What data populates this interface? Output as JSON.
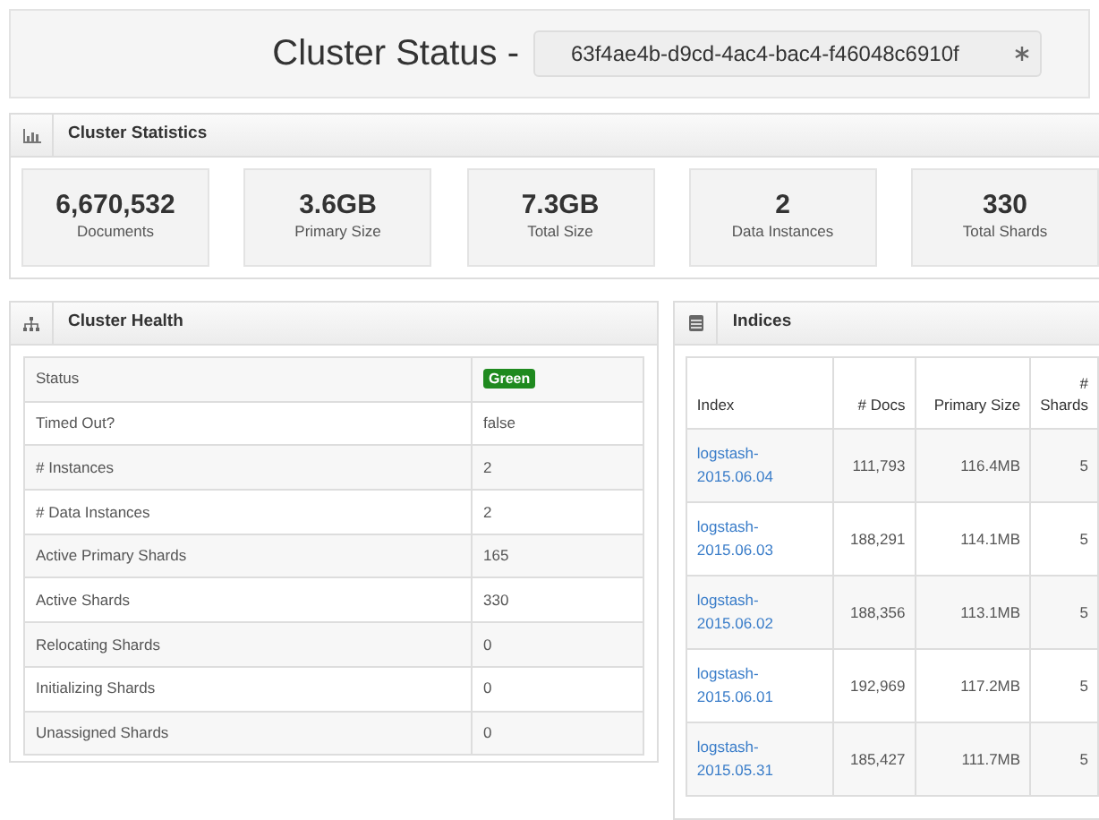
{
  "header": {
    "title": "Cluster Status -",
    "cluster_id": "63f4ae4b-d9cd-4ac4-bac4-f46048c6910f"
  },
  "statistics": {
    "title": "Cluster Statistics",
    "items": [
      {
        "value": "6,670,532",
        "label": "Documents"
      },
      {
        "value": "3.6GB",
        "label": "Primary Size"
      },
      {
        "value": "7.3GB",
        "label": "Total Size"
      },
      {
        "value": "2",
        "label": "Data Instances"
      },
      {
        "value": "330",
        "label": "Total Shards"
      }
    ]
  },
  "health": {
    "title": "Cluster Health",
    "rows": [
      {
        "kind": "badge",
        "label": "Status",
        "value": "Green",
        "color": "#1f8a1f"
      },
      {
        "kind": "text",
        "label": "Timed Out?",
        "value": "false"
      },
      {
        "kind": "text",
        "label": "# Instances",
        "value": "2"
      },
      {
        "kind": "text",
        "label": "# Data Instances",
        "value": "2"
      },
      {
        "kind": "text",
        "label": "Active Primary Shards",
        "value": "165"
      },
      {
        "kind": "text",
        "label": "Active Shards",
        "value": "330"
      },
      {
        "kind": "text",
        "label": "Relocating Shards",
        "value": "0"
      },
      {
        "kind": "text",
        "label": "Initializing Shards",
        "value": "0"
      },
      {
        "kind": "text",
        "label": "Unassigned Shards",
        "value": "0"
      }
    ]
  },
  "indices": {
    "title": "Indices",
    "columns": [
      "Index",
      "# Docs",
      "Primary Size",
      "# Shards"
    ],
    "rows": [
      {
        "index": "logstash-2015.06.04",
        "docs": "111,793",
        "primary_size": "116.4MB",
        "shards": "5"
      },
      {
        "index": "logstash-2015.06.03",
        "docs": "188,291",
        "primary_size": "114.1MB",
        "shards": "5"
      },
      {
        "index": "logstash-2015.06.02",
        "docs": "188,356",
        "primary_size": "113.1MB",
        "shards": "5"
      },
      {
        "index": "logstash-2015.06.01",
        "docs": "192,969",
        "primary_size": "117.2MB",
        "shards": "5"
      },
      {
        "index": "logstash-2015.05.31",
        "docs": "185,427",
        "primary_size": "111.7MB",
        "shards": "5"
      }
    ]
  }
}
